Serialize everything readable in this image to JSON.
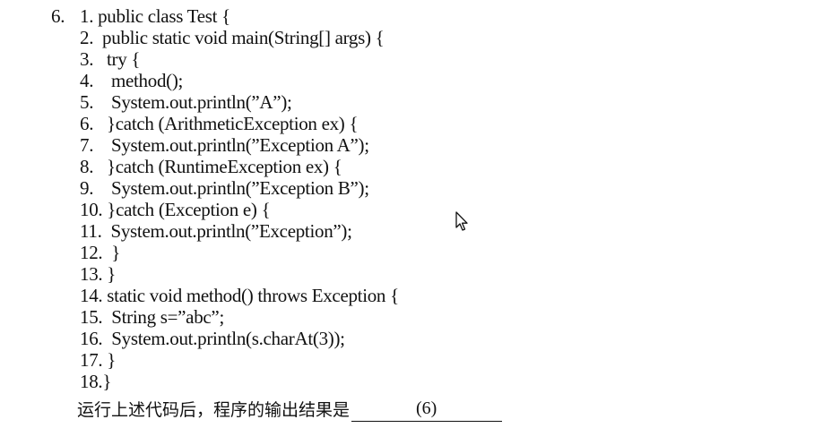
{
  "question_number": "6.",
  "code_lines": [
    "1. public class Test {",
    "2.  public static void main(String[] args) {",
    "3.   try {",
    "4.    method();",
    "5.    System.out.println(”A”);",
    "6.   }catch (ArithmeticException ex) {",
    "7.    System.out.println(”Exception A”);",
    "8.   }catch (RuntimeException ex) {",
    "9.    System.out.println(”Exception B”);",
    "10. }catch (Exception e) {",
    "11.  System.out.println(”Exception”);",
    "12.  }",
    "13. }",
    "14. static void method() throws Exception {",
    "15.  String s=”abc”;",
    "16.  System.out.println(s.charAt(3));",
    "17. }",
    "18.}"
  ],
  "question_text": "运行上述代码后，程序的输出结果是",
  "blank_label": "(6)",
  "colors": {
    "text": "#111111",
    "background": "#ffffff"
  },
  "cursor_icon": "mouse-pointer-icon"
}
